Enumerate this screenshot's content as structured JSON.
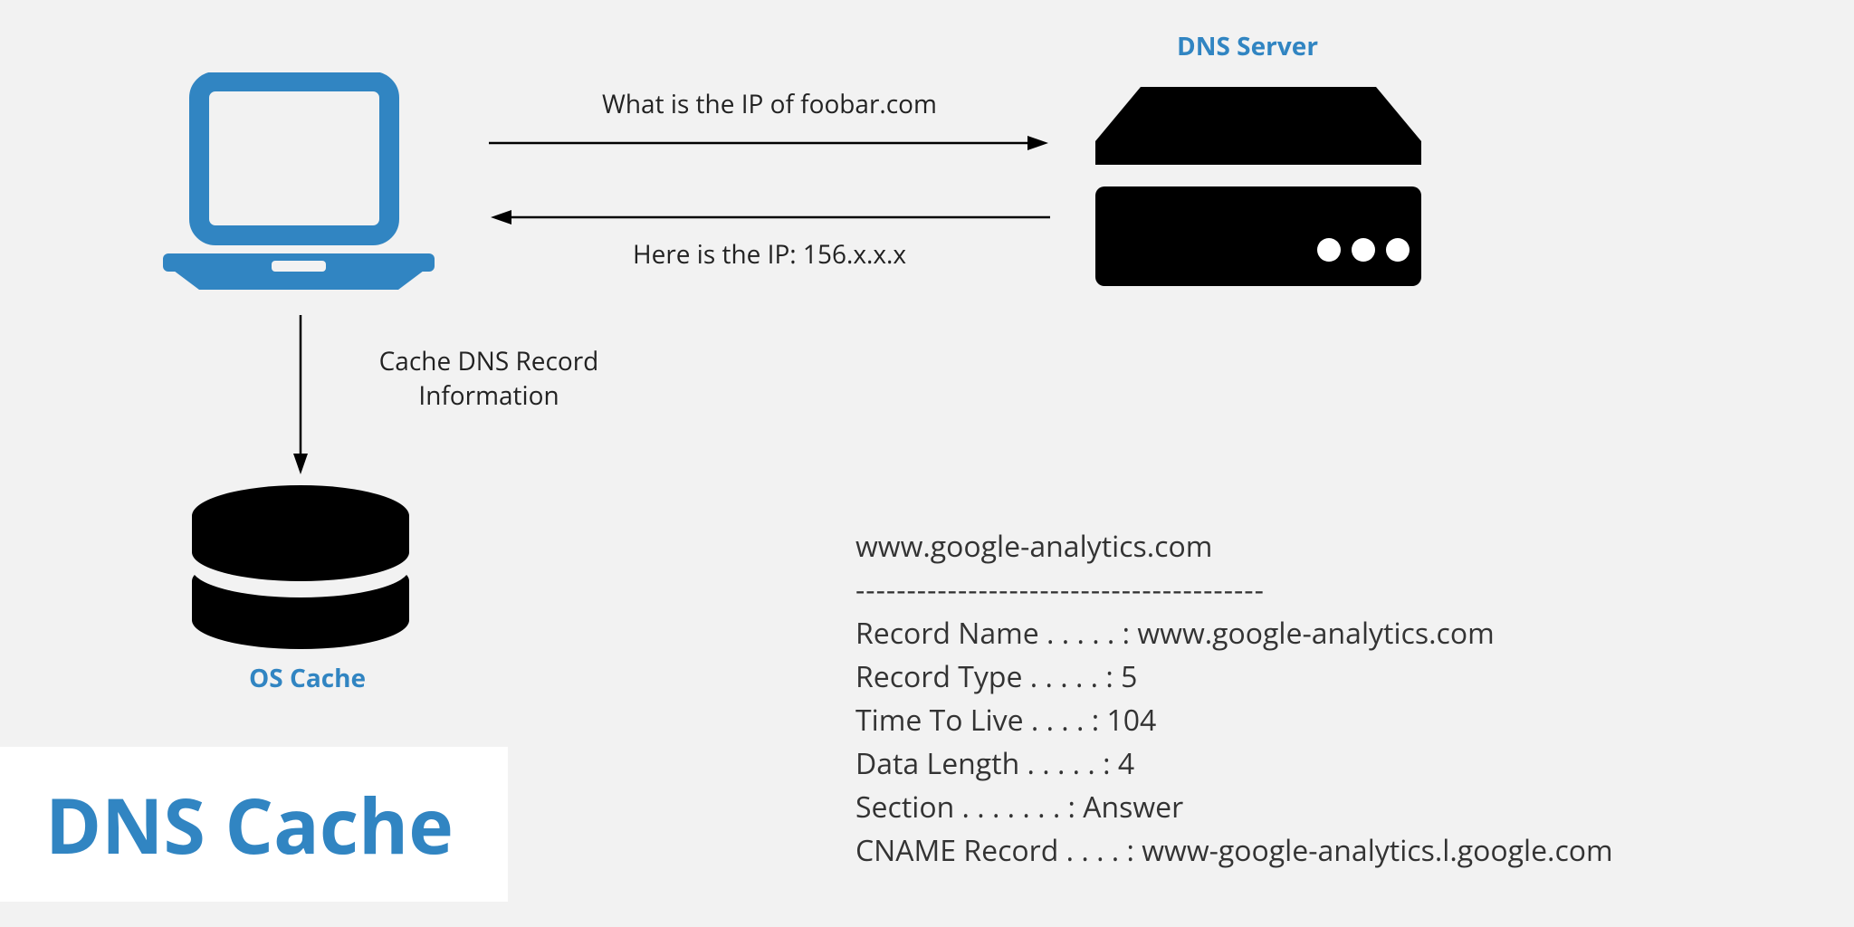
{
  "title": "DNS Cache",
  "labels": {
    "dns_server": "DNS Server",
    "os_cache": "OS Cache",
    "query": "What is the IP of foobar.com",
    "response": "Here is the IP: 156.x.x.x",
    "cache_line1": "Cache DNS Record",
    "cache_line2": "Information"
  },
  "dns_record": {
    "domain": "www.google-analytics.com",
    "separator": "----------------------------------------",
    "record_name": "Record Name . . . . . : www.google-analytics.com",
    "record_type": "Record Type . . . . . : 5",
    "ttl": "Time To Live  . . . . : 104",
    "data_length": "Data Length . . . . . : 4",
    "section": "Section . . . . . . . : Answer",
    "cname": "CNAME Record  . . . . : www-google-analytics.l.google.com"
  },
  "icons": {
    "laptop": "laptop-icon",
    "server": "server-icon",
    "disk": "disk-icon"
  },
  "colors": {
    "accent": "#3185c2",
    "black": "#000000"
  }
}
